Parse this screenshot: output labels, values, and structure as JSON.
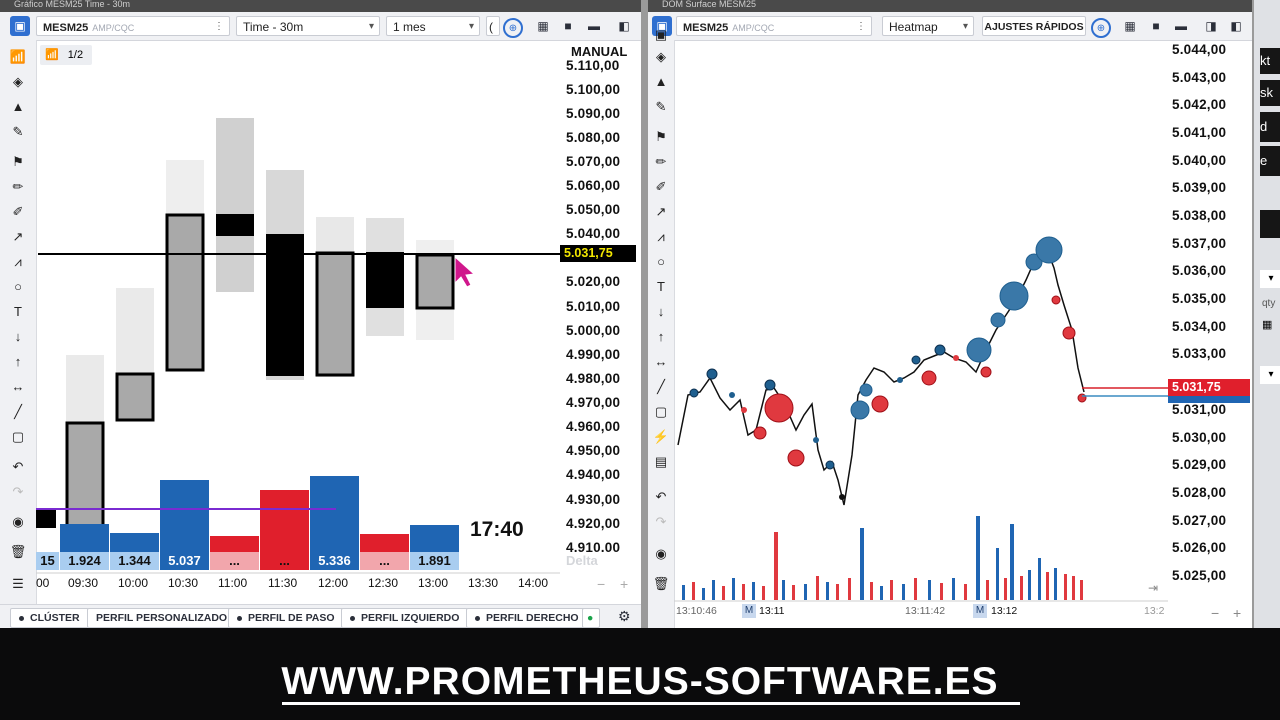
{
  "left": {
    "title": "Gráfico MESM25 Time - 30m",
    "symbol": "MESM25",
    "exchange": "AMP/CQC",
    "timeframe": "Time - 30m",
    "period": "1 mes",
    "mode_label": "MANUAL",
    "page_indicator": "1/2",
    "countdown": "17:40",
    "delta_label": "Delta",
    "current_price": "5.031,75",
    "price_axis": [
      "5.110,00",
      "5.100,00",
      "5.090,00",
      "5.080,00",
      "5.070,00",
      "5.060,00",
      "5.050,00",
      "5.040,00",
      "5.020,00",
      "5.010,00",
      "5.000,00",
      "4.990,00",
      "4.980,00",
      "4.970,00",
      "4.960,00",
      "4.950,00",
      "4.940,00",
      "4.930,00",
      "4.920,00",
      "4.910,00"
    ],
    "time_axis": [
      "00",
      "09:30",
      "10:00",
      "10:30",
      "11:00",
      "11:30",
      "12:00",
      "12:30",
      "13:00",
      "13:30",
      "14:00"
    ],
    "volume_labels": [
      "15",
      "1.924",
      "1.344",
      "5.037",
      "...",
      "...",
      "5.336",
      "...",
      "1.891"
    ],
    "bottom_tabs": [
      "CLÚSTER",
      "PERFIL PERSONALIZADO",
      "PERFIL DE PASO",
      "PERFIL IZQUIERDO",
      "PERFIL DERECHO"
    ],
    "colors": {
      "buy": "#1f65b3",
      "sell": "#e01f2c",
      "box_fill": "#a9a9a9"
    }
  },
  "right": {
    "title": "DOM Surface MESM25",
    "symbol": "MESM25",
    "exchange": "AMP/CQC",
    "view": "Heatmap",
    "quick_settings": "AJUSTES RÁPIDOS",
    "current_price": "5.031,75",
    "price_axis": [
      "5.044,00",
      "5.043,00",
      "5.042,00",
      "5.041,00",
      "5.040,00",
      "5.039,00",
      "5.038,00",
      "5.037,00",
      "5.036,00",
      "5.035,00",
      "5.034,00",
      "5.033,00",
      "5.032,00",
      "5.031,00",
      "5.030,00",
      "5.029,00",
      "5.028,00",
      "5.027,00",
      "5.026,00",
      "5.025,00"
    ],
    "time_axis": [
      "13:10:46",
      "13:11",
      "13:11:42",
      "13:12",
      "13:2"
    ],
    "time_markers": [
      "M",
      "M"
    ],
    "edge_labels": [
      "kt",
      "sk",
      "d",
      "e",
      "qty"
    ]
  },
  "footer": {
    "website": "WWW.PROMETHEUS-SOFTWARE.ES"
  }
}
